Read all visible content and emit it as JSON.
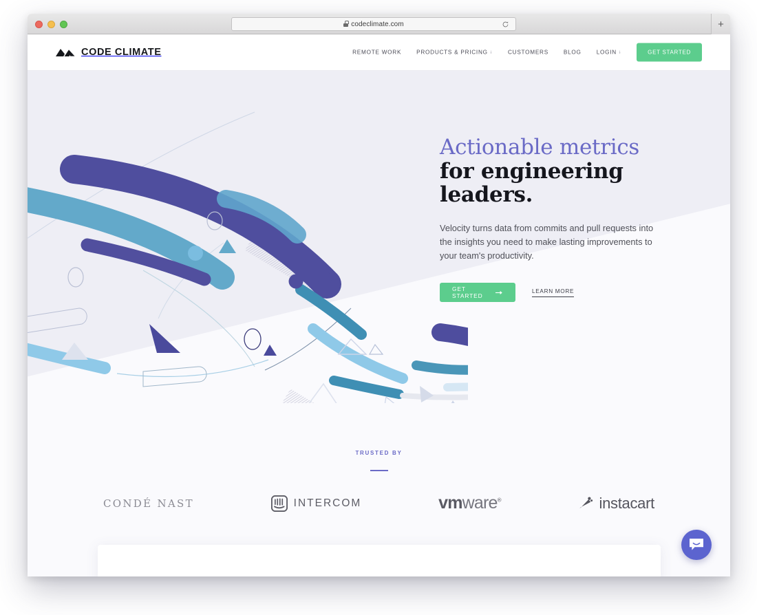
{
  "browser": {
    "url": "codeclimate.com",
    "lock_icon": "lock-icon",
    "reload_icon": "reload-icon",
    "new_tab_label": "+",
    "traffic_lights": [
      "close",
      "minimize",
      "maximize"
    ]
  },
  "header": {
    "brand": "CODE CLIMATE",
    "logo_icon": "mountain-peaks-icon",
    "nav": [
      {
        "label": "REMOTE WORK",
        "has_caret": false
      },
      {
        "label": "PRODUCTS & PRICING",
        "has_caret": true
      },
      {
        "label": "CUSTOMERS",
        "has_caret": false
      },
      {
        "label": "BLOG",
        "has_caret": false
      },
      {
        "label": "LOGIN",
        "has_caret": true
      }
    ],
    "cta_label": "GET STARTED",
    "caret_glyph": "↓"
  },
  "hero": {
    "title_line1": "Actionable metrics",
    "title_line2": "for engineering leaders.",
    "subtitle": "Velocity turns data from commits and pull requests into the insights you need to make lasting improvements to your team's productivity.",
    "cta_label": "GET STARTED",
    "cta_icon": "arrow-right-icon",
    "secondary_label": "LEARN MORE",
    "illustration_name": "abstract-data-streams-illustration"
  },
  "trusted": {
    "label": "TRUSTED BY",
    "logos": [
      {
        "name": "conde-nast",
        "text": "CONDÉ NAST"
      },
      {
        "name": "intercom",
        "text": "INTERCOM",
        "icon": "intercom-icon"
      },
      {
        "name": "vmware",
        "text_bold": "vm",
        "text_light": "ware",
        "mark": "®"
      },
      {
        "name": "instacart",
        "text": "instacart",
        "icon": "carrot-icon"
      }
    ]
  },
  "widgets": {
    "intercom_launcher_icon": "chat-bubble-smile-icon"
  },
  "colors": {
    "accent_green": "#5ccd8d",
    "accent_purple": "#6a6ac6",
    "indigo": "#4f4e9e",
    "blue": "#63a9ca",
    "light_blue": "#8fc9e8",
    "page_bg": "#fafafd",
    "hero_bg": "#eeeef5",
    "intercom_purple": "#5c64cf"
  }
}
